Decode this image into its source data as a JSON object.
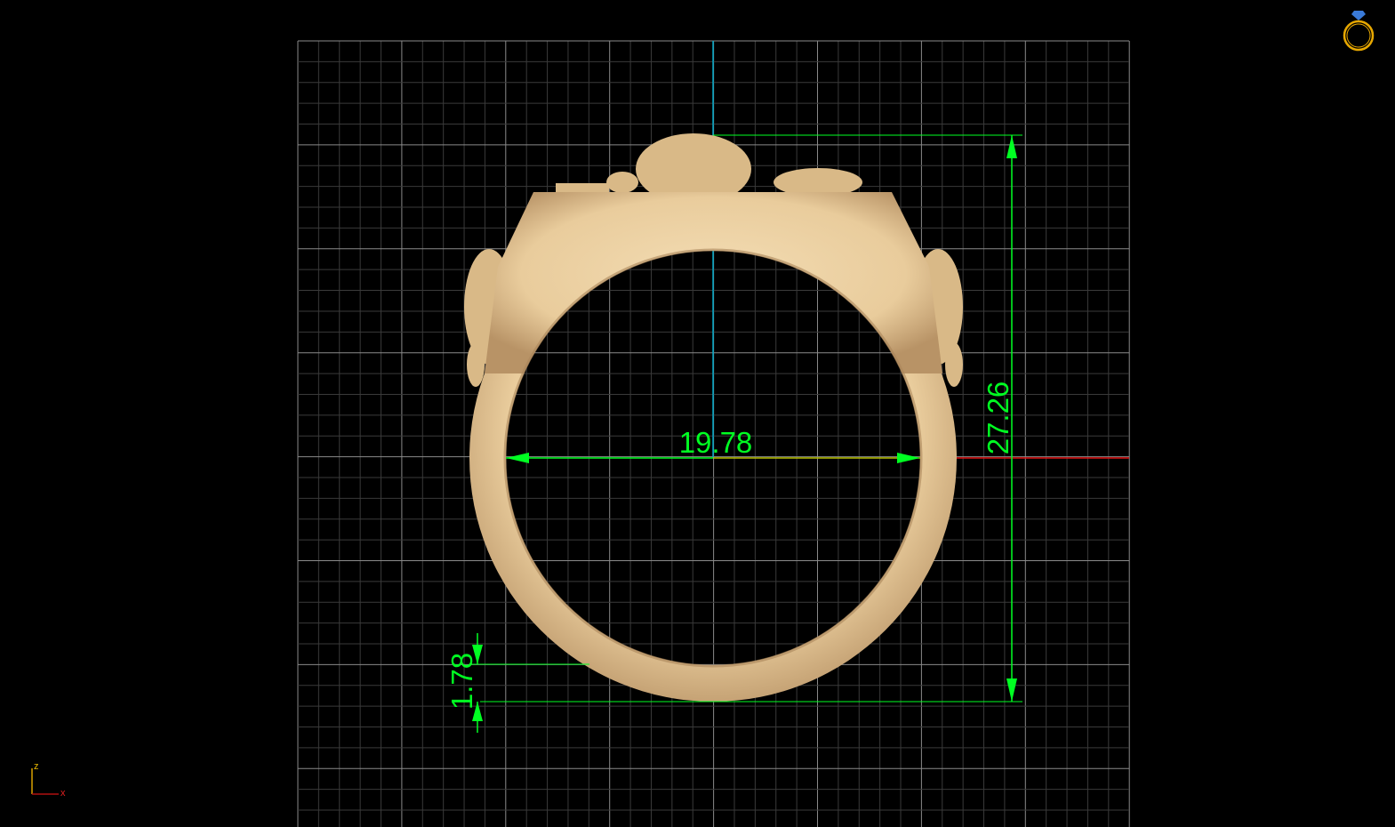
{
  "viewport": {
    "view": "front",
    "dimensions": {
      "inner_diameter": "19.78",
      "total_height": "27.26",
      "band_thickness": "1.78"
    },
    "axis_indicator": {
      "vertical": "z",
      "horizontal": "x"
    },
    "logo_icon": "ring-diamond-icon",
    "colors": {
      "dimension": "#00ff22",
      "ring_metal": "#e9cc9c",
      "x_axis": "#e01010",
      "z_axis": "#00a8c8",
      "grid_major": "#8a8a8a",
      "grid_minor": "#3a3a3a"
    }
  }
}
